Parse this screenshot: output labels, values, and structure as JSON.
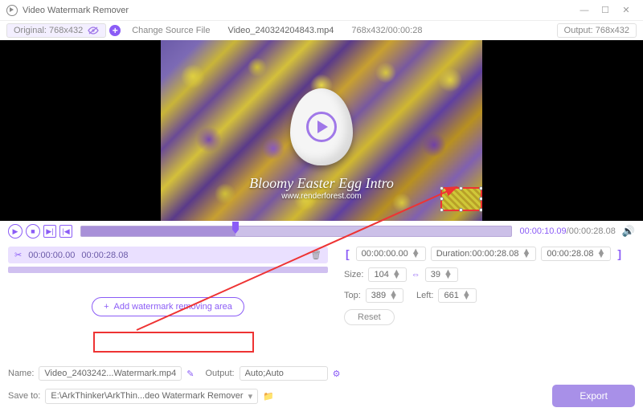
{
  "app": {
    "title": "Video Watermark Remover"
  },
  "header": {
    "original": "Original: 768x432",
    "change_source": "Change Source File",
    "filename": "Video_240324204843.mp4",
    "dims_dur": "768x432/00:00:28",
    "output": "Output: 768x432"
  },
  "preview": {
    "caption_line1": "Bloomy Easter Egg Intro",
    "caption_line2": "www.renderforest.com"
  },
  "playback": {
    "current": "00:00:10.09",
    "total": "/00:00:28.08"
  },
  "segment": {
    "start": "00:00:00.00",
    "end": "00:00:28.08"
  },
  "trim": {
    "start_label": "00:00:00.00",
    "duration_label": "Duration:00:00:28.08",
    "end_label": "00:00:28.08"
  },
  "size": {
    "label": "Size:",
    "w": "104",
    "h": "39"
  },
  "pos": {
    "top_label": "Top:",
    "top": "389",
    "left_label": "Left:",
    "left": "661"
  },
  "buttons": {
    "add_area": "Add watermark removing area",
    "reset": "Reset",
    "export": "Export"
  },
  "footer": {
    "name_label": "Name:",
    "name_value": "Video_2403242...Watermark.mp4",
    "output_label": "Output:",
    "output_value": "Auto;Auto",
    "save_label": "Save to:",
    "save_value": "E:\\ArkThinker\\ArkThin...deo Watermark Remover"
  }
}
